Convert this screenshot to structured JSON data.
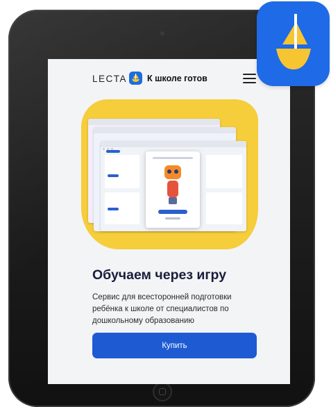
{
  "header": {
    "logo_text": "LECTA",
    "product_name": "К школе готов"
  },
  "hero": {
    "title": "Обучаем через игру",
    "description": "Сервис для всесторонней подготовки ребёнка к школе от специалистов по дошкольному образованию",
    "buy_label": "Купить"
  },
  "icons": {
    "menu": "hamburger-menu-icon",
    "logo": "sailboat-icon",
    "app_icon": "sailboat-app-icon"
  },
  "colors": {
    "accent": "#1e5bd3",
    "blob": "#f6cd3a",
    "app_icon_bg": "#1f6ae6",
    "sail_yellow": "#f7c531"
  }
}
